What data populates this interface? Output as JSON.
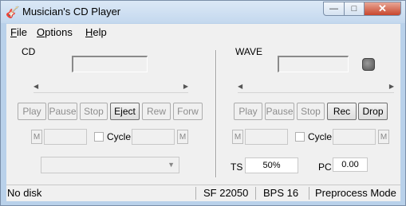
{
  "window": {
    "title": "Musician's CD Player",
    "app_icon": "guitar-icon",
    "controls": {
      "minimize": "—",
      "maximize": "□",
      "close": "✕"
    }
  },
  "menu": [
    "File",
    "Options",
    "Help"
  ],
  "cd": {
    "label": "CD",
    "buttons": {
      "play": "Play",
      "pause": "Pause",
      "stop": "Stop",
      "eject": "Eject",
      "rew": "Rew",
      "forw": "Forw"
    },
    "marker_left": "M",
    "marker_right": "M",
    "cycle_label": "Cycle",
    "cycle_checked": false
  },
  "wave": {
    "label": "WAVE",
    "buttons": {
      "play": "Play",
      "pause": "Pause",
      "stop": "Stop",
      "rec": "Rec",
      "drop": "Drop"
    },
    "marker_left": "M",
    "marker_right": "M",
    "cycle_label": "Cycle",
    "cycle_checked": false,
    "ts_label": "TS",
    "ts_value": "50%",
    "pc_label": "PC",
    "pc_value": "0.00"
  },
  "status": {
    "disk": "No disk",
    "sf": "SF 22050",
    "bps": "BPS 16",
    "mode": "Preprocess Mode"
  }
}
